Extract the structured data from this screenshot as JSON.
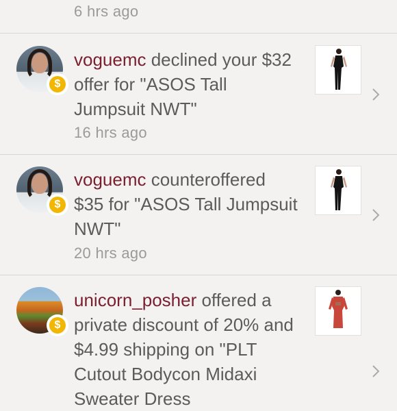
{
  "top_time": "6 hrs ago",
  "notifications": [
    {
      "username": "voguemc",
      "text": " declined your $32 offer for \"ASOS Tall Jumpsuit NWT\"",
      "time": "16 hrs ago",
      "badge_symbol": "$",
      "thumb": "black-jumpsuit"
    },
    {
      "username": "voguemc",
      "text": " counteroffered $35 for \"ASOS Tall Jumpsuit NWT\"",
      "time": "20 hrs ago",
      "badge_symbol": "$",
      "thumb": "black-jumpsuit"
    },
    {
      "username": "unicorn_posher",
      "text": " offered a private discount of 20% and $4.99 shipping on \"PLT Cutout Bodycon Midaxi Sweater Dress",
      "badge_symbol": "$",
      "thumb": "red-bodycon-dress"
    }
  ],
  "colors": {
    "background": "#f4f2f1",
    "username": "#7a1f2e",
    "body_text": "#5b5b5b",
    "time_text": "#9a9a9a",
    "badge": "#f2b705",
    "divider": "#d9d6d4"
  },
  "icons": {
    "badge": "dollar-coin-icon",
    "chevron": "chevron-right-icon"
  }
}
